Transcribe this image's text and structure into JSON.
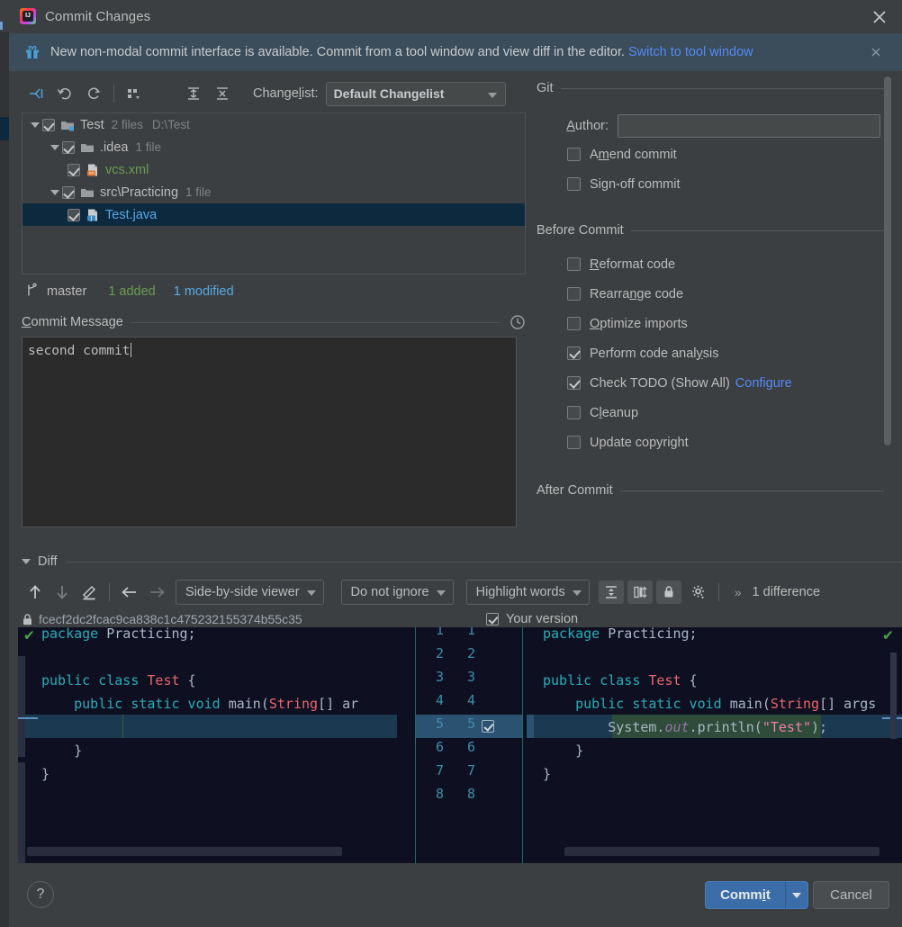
{
  "window": {
    "title": "Commit Changes",
    "app_icon": "intellij-idea-icon",
    "close_icon": "close-icon"
  },
  "banner": {
    "icon": "gift-icon",
    "text": "New non-modal commit interface is available. Commit from a tool window and view diff in the editor.",
    "link": "Switch to tool window",
    "close_icon": "close-icon"
  },
  "toolbar": {
    "buttons": [
      {
        "name": "show-diff-icon",
        "title": "Show Diff"
      },
      {
        "name": "revert-icon",
        "title": "Revert"
      },
      {
        "name": "refresh-icon",
        "title": "Refresh"
      },
      {
        "name": "group-by-icon",
        "title": "Group By"
      },
      {
        "name": "expand-all-icon",
        "title": "Expand All"
      },
      {
        "name": "collapse-all-icon",
        "title": "Collapse All"
      }
    ],
    "changelist_label": "Changelist:",
    "changelist_mnemonic": "l",
    "changelist_value": "Default Changelist"
  },
  "tree": [
    {
      "indent": 0,
      "arrow": true,
      "checked": true,
      "icon": "module-folder-icon",
      "name": "Test",
      "name_color": "default",
      "meta1": "2 files",
      "meta2": "D:\\Test",
      "selected": false
    },
    {
      "indent": 1,
      "arrow": true,
      "checked": true,
      "icon": "folder-icon",
      "name": ".idea",
      "name_color": "default",
      "meta1": "1 file",
      "meta2": "",
      "selected": false
    },
    {
      "indent": 2,
      "arrow": false,
      "checked": true,
      "icon": "xml-file-icon",
      "name": "vcs.xml",
      "name_color": "green",
      "meta1": "",
      "meta2": "",
      "selected": false
    },
    {
      "indent": 1,
      "arrow": true,
      "checked": true,
      "icon": "folder-icon",
      "name": "src\\Practicing",
      "name_color": "default",
      "meta1": "1 file",
      "meta2": "",
      "selected": false
    },
    {
      "indent": 2,
      "arrow": false,
      "checked": true,
      "icon": "java-file-icon",
      "name": "Test.java",
      "name_color": "blue",
      "meta1": "",
      "meta2": "",
      "selected": true
    }
  ],
  "tree_status": {
    "branch_icon": "git-branch-icon",
    "branch": "master",
    "added": "1 added",
    "modified": "1 modified"
  },
  "commit_message": {
    "label": "Commit Message",
    "mnemonic": "C",
    "history_icon": "clock-history-icon",
    "value": "second commit"
  },
  "options": {
    "git_group": "Git",
    "author_label": "Author:",
    "author_mnemonic": "A",
    "author_value": "",
    "author_placeholder": "",
    "git_items": [
      {
        "label_pre": "A",
        "label_mn": "m",
        "label_post": "end commit",
        "checked": false,
        "name": "amend-commit"
      },
      {
        "label_pre": "Si",
        "label_mn": "g",
        "label_post": "n-off commit",
        "checked": false,
        "name": "sign-off-commit"
      }
    ],
    "before_group": "Before Commit",
    "before_items": [
      {
        "label_pre": "",
        "label_mn": "R",
        "label_post": "eformat code",
        "checked": false,
        "name": "reformat-code"
      },
      {
        "label_pre": "Rearra",
        "label_mn": "n",
        "label_post": "ge code",
        "checked": false,
        "name": "rearrange-code"
      },
      {
        "label_pre": "",
        "label_mn": "O",
        "label_post": "ptimize imports",
        "checked": false,
        "name": "optimize-imports"
      },
      {
        "label_pre": "Perform code anal",
        "label_mn": "y",
        "label_post": "sis",
        "checked": true,
        "name": "perform-code-analysis"
      },
      {
        "label_pre": "Check TODO (Show All)",
        "label_mn": "",
        "label_post": "",
        "checked": true,
        "name": "check-todo",
        "link": "Configure"
      },
      {
        "label_pre": "C",
        "label_mn": "l",
        "label_post": "eanup",
        "checked": false,
        "name": "cleanup"
      },
      {
        "label_pre": "Update copyright",
        "label_mn": "",
        "label_post": "",
        "checked": false,
        "name": "update-copyright"
      }
    ],
    "after_group": "After Commit"
  },
  "diff": {
    "section_label": "Diff",
    "nav_prev_icon": "arrow-up-icon",
    "nav_next_icon": "arrow-down-icon",
    "edit_icon": "pencil-icon",
    "back_icon": "arrow-left-icon",
    "forward_icon": "arrow-right-icon",
    "viewer_mode": "Side-by-side viewer",
    "ignore_mode": "Do not ignore",
    "highlight_mode": "Highlight words",
    "collapse_icon": "collapse-unchanged-icon",
    "columns_icon": "synchronize-scroll-icon",
    "lock_icon": "read-only-lock-icon",
    "settings_icon": "gear-icon",
    "more_icon": "chevron-right-double-icon",
    "difference_count": "1 difference",
    "revision_lock_icon": "lock-icon",
    "revision_hash": "fcecf2dc2fcac9ca838c1c475232155374b55c35",
    "your_version_label": "Your version",
    "your_version_checked": true,
    "left_lines": [
      {
        "num": "1",
        "segments": [
          {
            "t": "package",
            "c": "kw"
          },
          {
            "t": " Practicing;",
            "c": "def"
          }
        ]
      },
      {
        "num": "2",
        "segments": []
      },
      {
        "num": "3",
        "segments": [
          {
            "t": "public class ",
            "c": "kw"
          },
          {
            "t": "Test",
            "c": "cls"
          },
          {
            "t": " {",
            "c": "def"
          }
        ]
      },
      {
        "num": "4",
        "segments": [
          {
            "t": "    public static void ",
            "c": "kw"
          },
          {
            "t": "main(",
            "c": "def"
          },
          {
            "t": "String",
            "c": "cls"
          },
          {
            "t": "[] ar",
            "c": "def"
          }
        ]
      },
      {
        "num": "5",
        "segments": [],
        "added_gap": true
      },
      {
        "num": "6",
        "segments": [
          {
            "t": "    }",
            "c": "def"
          }
        ]
      },
      {
        "num": "7",
        "segments": [
          {
            "t": "}",
            "c": "def"
          }
        ]
      },
      {
        "num": "8",
        "segments": []
      }
    ],
    "right_lines": [
      {
        "num": "1",
        "segments": [
          {
            "t": "package",
            "c": "kw"
          },
          {
            "t": " Practicing;",
            "c": "def"
          }
        ]
      },
      {
        "num": "2",
        "segments": []
      },
      {
        "num": "3",
        "segments": [
          {
            "t": "public class ",
            "c": "kw"
          },
          {
            "t": "Test",
            "c": "cls"
          },
          {
            "t": " {",
            "c": "def"
          }
        ]
      },
      {
        "num": "4",
        "segments": [
          {
            "t": "    public static void ",
            "c": "kw"
          },
          {
            "t": "main(",
            "c": "def"
          },
          {
            "t": "String",
            "c": "cls"
          },
          {
            "t": "[] args",
            "c": "def"
          }
        ]
      },
      {
        "num": "5",
        "segments": [
          {
            "t": "        System.",
            "c": "def"
          },
          {
            "t": "out",
            "c": "fld"
          },
          {
            "t": ".println(",
            "c": "def"
          },
          {
            "t": "\"Test\"",
            "c": "str"
          },
          {
            "t": ");",
            "c": "def"
          }
        ],
        "added": true
      },
      {
        "num": "6",
        "segments": [
          {
            "t": "    }",
            "c": "def"
          }
        ]
      },
      {
        "num": "7",
        "segments": [
          {
            "t": "}",
            "c": "def"
          }
        ]
      },
      {
        "num": "8",
        "segments": []
      }
    ],
    "gutter_numbers": [
      "1",
      "2",
      "3",
      "4",
      "5",
      "6",
      "7",
      "8"
    ],
    "accepted_line": "5"
  },
  "footer": {
    "help_icon": "question-mark-icon",
    "commit_label": "Commit",
    "commit_mnemonic": "i",
    "commit_dropdown_icon": "chevron-down-icon",
    "cancel_label": "Cancel"
  },
  "colors": {
    "accent_blue": "#3b6ea8",
    "link_blue": "#548af7",
    "added_green": "#6a9c55",
    "modified_blue": "#57a8e5",
    "selection": "#0d293e",
    "editor_bg": "#0e1021"
  }
}
